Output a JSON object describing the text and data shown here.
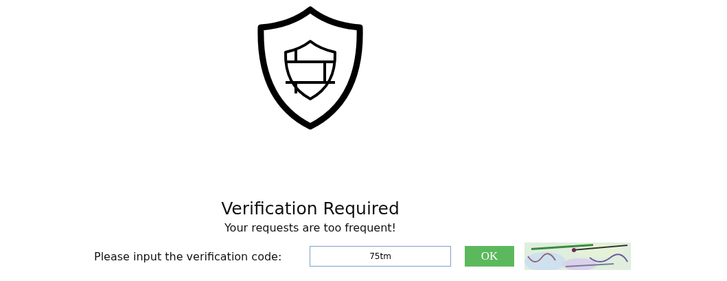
{
  "heading": "Verification Required",
  "message": "Your requests are too frequent!",
  "form": {
    "label": "Please input the verification code:",
    "value": "75tm",
    "button": "OK"
  }
}
